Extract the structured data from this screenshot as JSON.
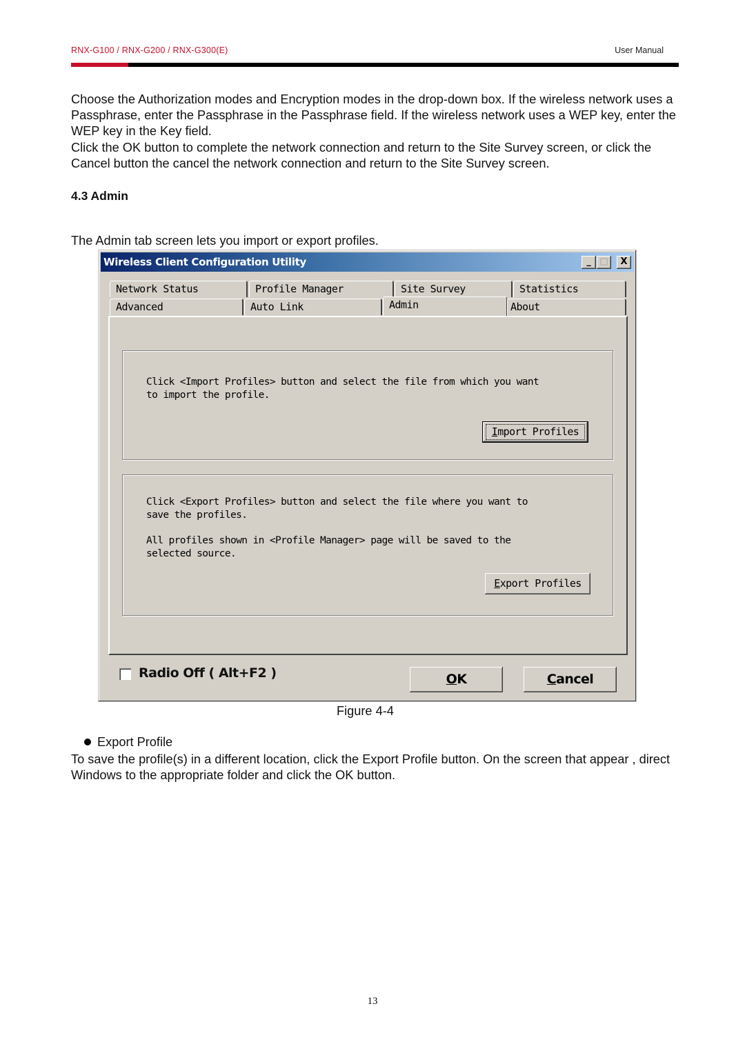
{
  "header": {
    "models": "RNX-G100 / RNX-G200 / RNX-G300(E)",
    "doc_type": "User Manual",
    "accent_color": "#c8102e"
  },
  "intro_paragraphs": [
    "Choose the Authorization modes and Encryption modes in the drop-down box. If the wireless network uses a Passphrase, enter the Passphrase in the Passphrase field. If the wireless network uses a WEP key, enter the WEP key in the Key field.",
    "Click the OK button to complete the network connection and return to the Site Survey screen, or click the Cancel button the cancel the network connection and return to the Site Survey screen."
  ],
  "section": {
    "heading": "4.3 Admin",
    "lead": "The Admin tab screen lets you import or export profiles."
  },
  "window": {
    "title": "Wireless Client Configuration Utility",
    "controls": {
      "minimize": "_",
      "maximize": "□",
      "close": "X"
    },
    "tabs_row1": [
      "Network Status",
      "Profile Manager",
      "Site Survey",
      "Statistics"
    ],
    "tabs_row2": [
      "Advanced",
      "Auto Link",
      "Admin",
      "About"
    ],
    "active_tab": "Admin",
    "import_group": {
      "text": "Click <Import Profiles> button and select the file from which you want\nto import the profile.",
      "button": {
        "accel": "I",
        "rest": "mport Profiles"
      }
    },
    "export_group": {
      "text1": "Click <Export Profiles> button and select the file where you want to\nsave the profiles.",
      "text2": "All profiles shown in <Profile Manager> page will be saved to the\nselected source.",
      "button": {
        "accel": "E",
        "rest": "xport Profiles"
      }
    },
    "radio_off": {
      "label": "Radio Off  ( Alt+F2 )",
      "checked": false
    },
    "ok_button": {
      "accel": "O",
      "rest": "K"
    },
    "cancel_button": {
      "accel": "C",
      "rest": "ancel"
    }
  },
  "figure_caption": "Figure 4-4",
  "bullet": "Export Profile",
  "closing_paragraph": "To save the profile(s) in a different location, click the Export Profile button. On the screen that appear , direct Windows to the appropriate folder and click the OK button.",
  "page_number": "13"
}
